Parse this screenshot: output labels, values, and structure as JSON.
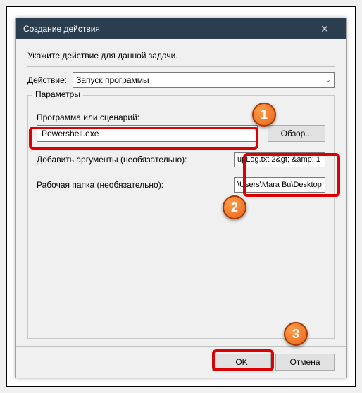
{
  "title": "Создание действия",
  "instruction": "Укажите действие для данной задачи.",
  "action_label": "Действие:",
  "action_value": "Запуск программы",
  "params_legend": "Параметры",
  "program_label": "Программа или сценарий:",
  "program_value": "Powershell.exe",
  "browse_label": "Обзор...",
  "arguments_label": "Добавить аргументы (необязательно):",
  "arguments_value": "upLog.txt 2&gt; &amp; 1",
  "workdir_label": "Рабочая папка (необязательно):",
  "workdir_value": "\\Users\\Mara Bu\\Desktop",
  "ok_label": "OK",
  "cancel_label": "Отмена",
  "callouts": {
    "c1": "1",
    "c2": "2",
    "c3": "3"
  }
}
